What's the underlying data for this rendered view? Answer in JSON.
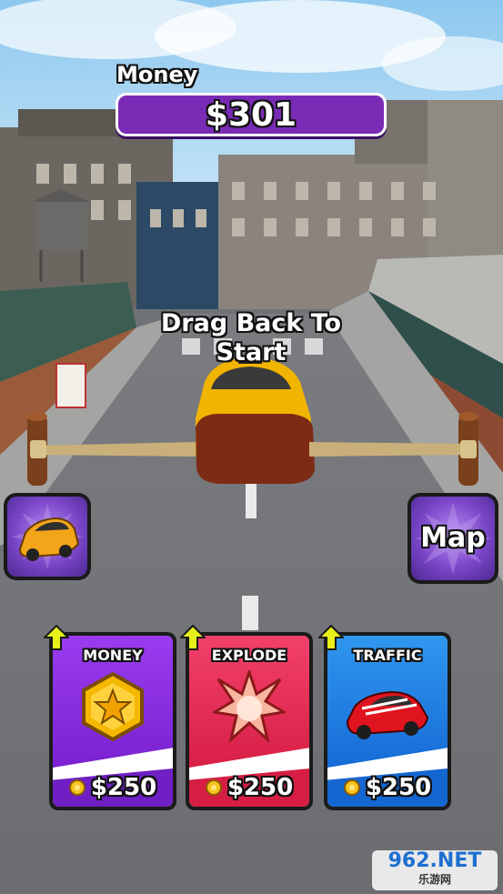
{
  "hud": {
    "money_label": "Money",
    "money_value": "$301"
  },
  "hint": {
    "line1": "Drag Back To",
    "line2": "Start"
  },
  "side_buttons": {
    "car_icon": "yellow-car-icon",
    "map_label": "Map"
  },
  "cards": [
    {
      "title": "MONEY",
      "icon": "gold-coin-star-icon",
      "price": "$250",
      "color_top": "#8c2fe0",
      "color_bottom": "#6f1fc4"
    },
    {
      "title": "EXPLODE",
      "icon": "explosion-icon",
      "price": "$250",
      "color_top": "#f0325f",
      "color_bottom": "#d61e45"
    },
    {
      "title": "TRAFFIC",
      "icon": "red-car-icon",
      "price": "$250",
      "color_top": "#2b8be8",
      "color_bottom": "#1466d1"
    }
  ],
  "colors": {
    "money_panel": "#7a2bb6",
    "side_button": "#7a46c8"
  },
  "watermark": {
    "text": "962.NET",
    "subtext": "乐游网"
  }
}
